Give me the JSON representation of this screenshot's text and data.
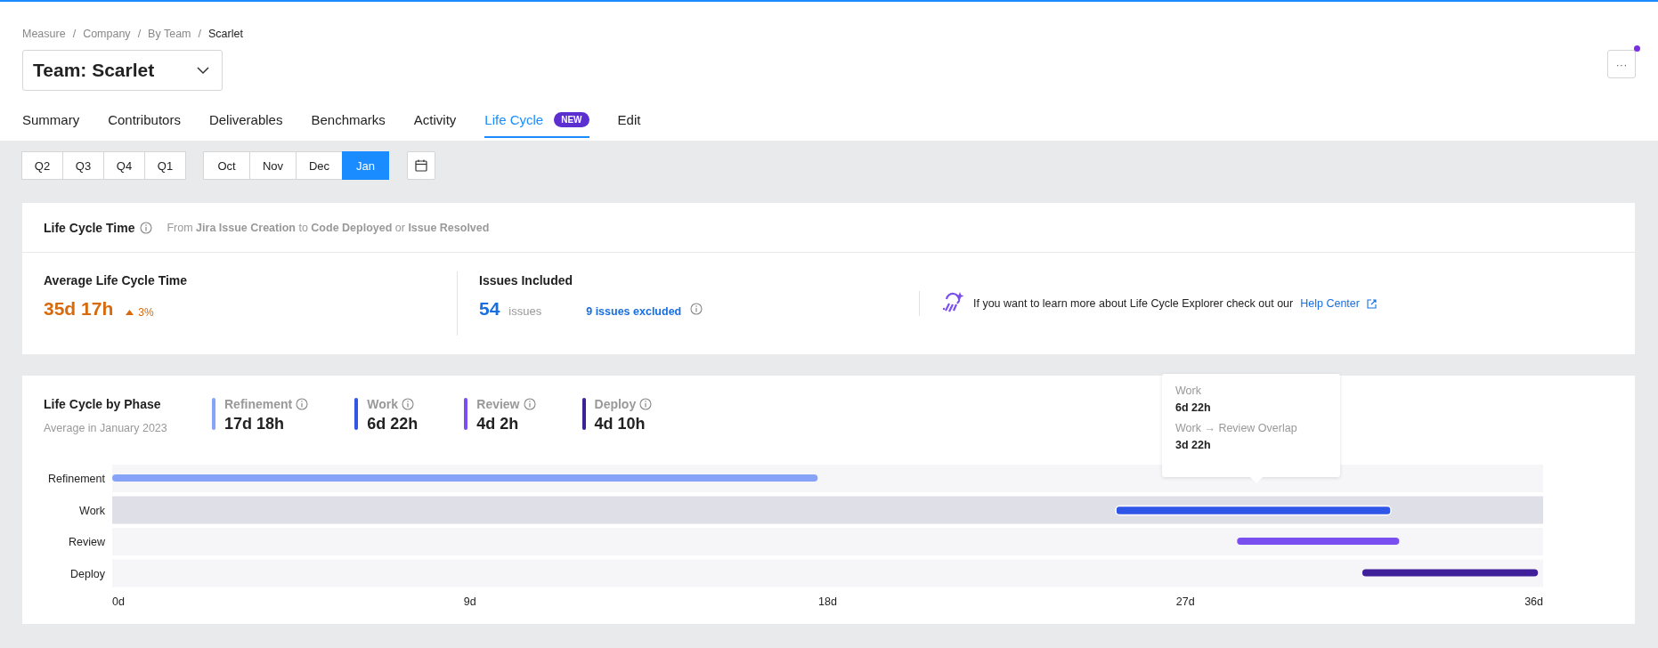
{
  "breadcrumb": [
    {
      "label": "Measure",
      "current": false
    },
    {
      "separator": "/",
      "label": "Company",
      "current": false
    },
    {
      "separator": "/",
      "label": "By Team",
      "current": false
    },
    {
      "separator": "/",
      "label": "Scarlet",
      "current": true
    }
  ],
  "team_select": {
    "value": "Team: Scarlet"
  },
  "more_button": {
    "label": "···",
    "notification": true
  },
  "tabs": [
    {
      "label": "Summary",
      "selected": false
    },
    {
      "label": "Contributors",
      "selected": false
    },
    {
      "label": "Deliverables",
      "selected": false
    },
    {
      "label": "Benchmarks",
      "selected": false
    },
    {
      "label": "Activity",
      "selected": false
    },
    {
      "label": "Life Cycle",
      "selected": true,
      "badge": "NEW"
    },
    {
      "label": "Edit",
      "selected": false
    }
  ],
  "quarters": [
    {
      "label": "Q2",
      "selected": false
    },
    {
      "label": "Q3",
      "selected": false
    },
    {
      "label": "Q4",
      "selected": false
    },
    {
      "label": "Q1",
      "selected": false
    }
  ],
  "months": [
    {
      "label": "Oct",
      "selected": false
    },
    {
      "label": "Nov",
      "selected": false
    },
    {
      "label": "Dec",
      "selected": false
    },
    {
      "label": "Jan",
      "selected": true
    }
  ],
  "life_cycle_time": {
    "title": "Life Cycle Time",
    "description": "From **Jira Issue Creation** to **Code Deployed** or **Issue Resolved**",
    "average": {
      "label": "Average Life Cycle Time",
      "value": "35d 17h",
      "change": "3%"
    },
    "issues": {
      "label": "Issues Included",
      "count": "54",
      "unit": "issues",
      "excluded_link": "9 issues excluded"
    },
    "help": {
      "text": "If you want to learn more about Life Cycle Explorer check out our",
      "link": "Help Center"
    }
  },
  "phase_section": {
    "title": "Life Cycle by Phase",
    "subtitle": "Average in January 2023",
    "phases": [
      {
        "name": "Refinement",
        "value": "17d 18h",
        "color": "#86a3f7",
        "selected": false
      },
      {
        "name": "Work",
        "value": "6d 22h",
        "color": "#2f56e6",
        "selected": true
      },
      {
        "name": "Review",
        "value": "4d 2h",
        "color": "#7a4ff0",
        "selected": false
      },
      {
        "name": "Deploy",
        "value": "4d 10h",
        "color": "#3f1f9a",
        "selected": false
      }
    ],
    "timeline": {
      "row_labels": [
        "Refinement",
        "Work",
        "Review",
        "Deploy"
      ],
      "axis_labels": [
        "0d",
        "9d",
        "18d",
        "27d",
        "36d"
      ]
    },
    "tooltip": [
      {
        "label": "Work",
        "value": "6d 22h"
      },
      {
        "label": "Work → Review Overlap",
        "value": "3d 22h"
      }
    ]
  }
}
